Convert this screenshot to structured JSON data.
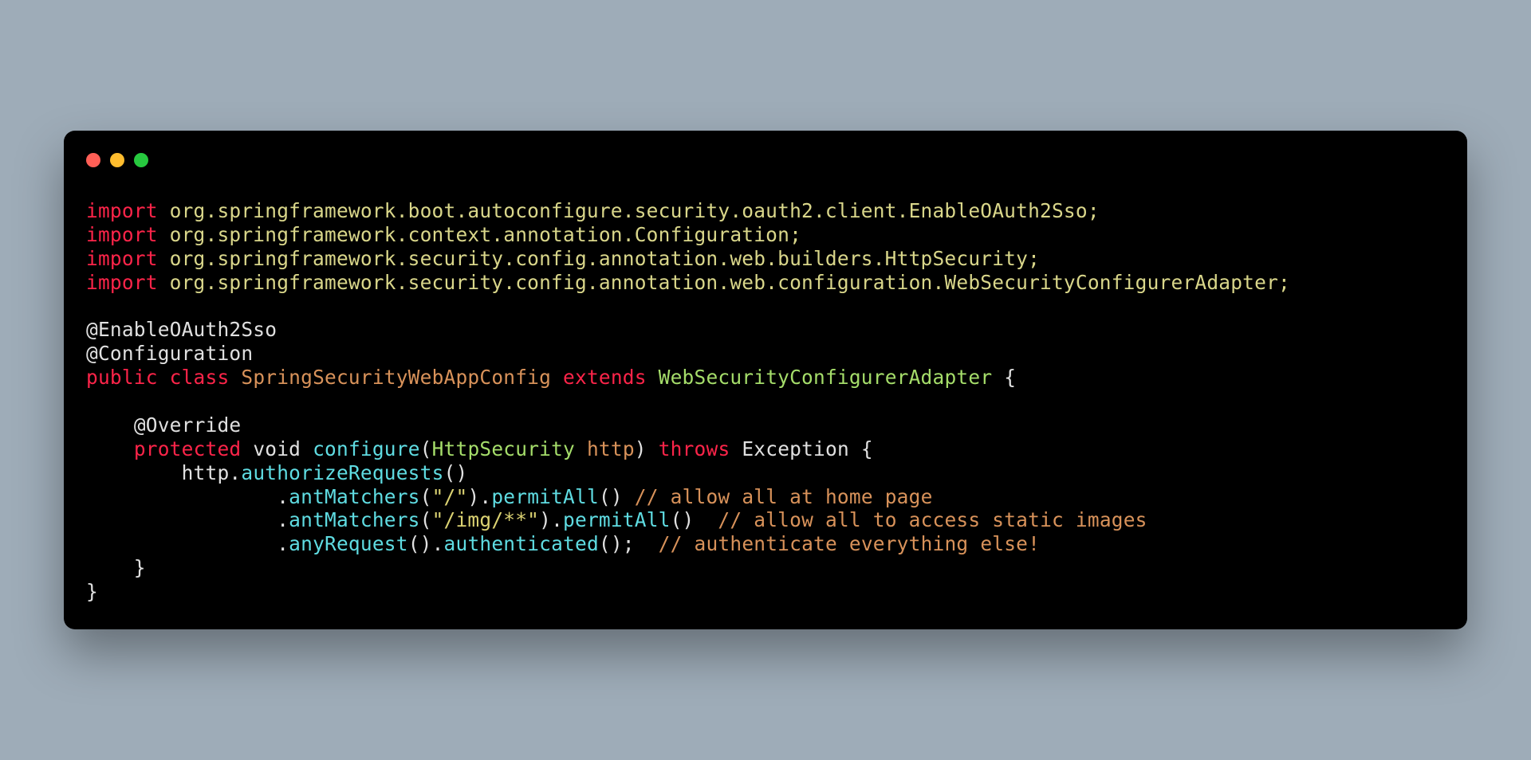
{
  "colors": {
    "bg": "#9eacb8",
    "window_bg": "#000000",
    "red_light": "#ff5f56",
    "yellow_light": "#ffbd2e",
    "green_light": "#27c93f",
    "keyword_red": "#fc2449",
    "text_default": "#e0e0e0",
    "text_yellow": "#d9d68a",
    "orange": "#d8925a",
    "green_text": "#a5dd6a",
    "string": "#dbd272",
    "cyan": "#5fdce2",
    "comment": "#7a7a7a"
  },
  "code": {
    "line1": {
      "kw": "import",
      "rest": " org.springframework.boot.autoconfigure.security.oauth2.client.EnableOAuth2Sso;"
    },
    "line2": {
      "kw": "import",
      "rest": " org.springframework.context.annotation.Configuration;"
    },
    "line3": {
      "kw": "import",
      "rest": " org.springframework.security.config.annotation.web.builders.HttpSecurity;"
    },
    "line4": {
      "kw": "import",
      "rest": " org.springframework.security.config.annotation.web.configuration.WebSecurityConfigurerAdapter;"
    },
    "line6_annot": "@EnableOAuth2Sso",
    "line7_annot": "@Configuration",
    "line8": {
      "public": "public",
      "class": "class",
      "name": "SpringSecurityWebAppConfig",
      "extends": "extends",
      "parent": "WebSecurityConfigurerAdapter",
      "brace": " {"
    },
    "line10_override": "@Override",
    "line11": {
      "indent": "    ",
      "protected": "protected",
      "void": "void",
      "configure": "configure",
      "paren_open": "(",
      "type": "HttpSecurity",
      "param": " http",
      "paren_close": ")",
      "throws": "throws",
      "exception": "Exception",
      "brace": " {"
    },
    "line12": {
      "indent": "        ",
      "http": "http",
      "dot": ".",
      "method": "authorizeRequests",
      "parens": "()"
    },
    "line13": {
      "indent": "                ",
      "dot": ".",
      "method": "antMatchers",
      "paren_open": "(",
      "string": "\"/\"",
      "paren_close": ")",
      "dot2": ".",
      "method2": "permitAll",
      "parens2": "() ",
      "comment": "// allow all at home page"
    },
    "line14": {
      "indent": "                ",
      "dot": ".",
      "method": "antMatchers",
      "paren_open": "(",
      "string": "\"/img/**\"",
      "paren_close": ")",
      "dot2": ".",
      "method2": "permitAll",
      "parens2": "()  ",
      "comment": "// allow all to access static images"
    },
    "line15": {
      "indent": "                ",
      "dot": ".",
      "method": "anyRequest",
      "parens": "()",
      "dot2": ".",
      "method2": "authenticated",
      "parens2": "();  ",
      "comment": "// authenticate everything else!"
    },
    "line16": "    }",
    "line17": "}"
  }
}
